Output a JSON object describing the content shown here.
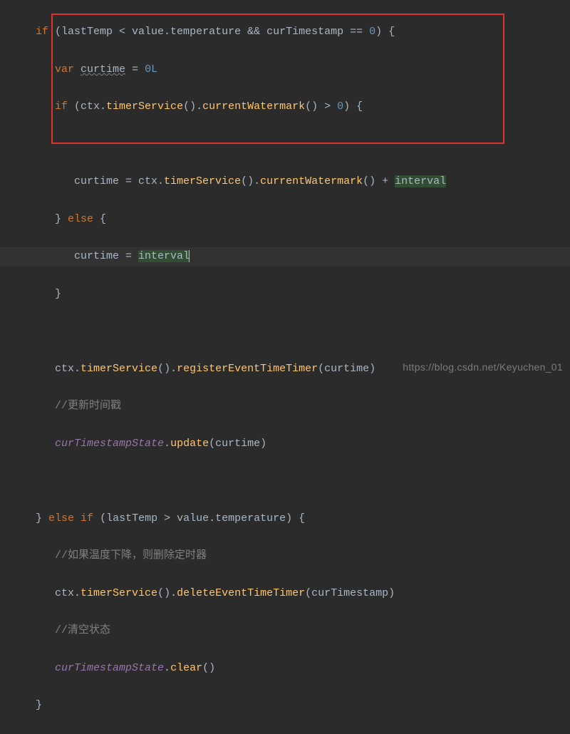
{
  "code": {
    "l1_if": "if",
    "l1_rest": " (lastTemp < value.temperature && curTimestamp == ",
    "l1_zero": "0",
    "l1_end": ") {",
    "l2_var": "var",
    "l2_sp": " ",
    "l2_curtime": "curtime",
    "l2_eq": " = ",
    "l2_val": "0L",
    "l3_if": "if",
    "l3_mid": " (ctx.",
    "l3_fn1": "timerService",
    "l3_mid2": "().",
    "l3_fn2": "currentWatermark",
    "l3_mid3": "() > ",
    "l3_zero": "0",
    "l3_end": ") {",
    "l5_a": "curtime = ctx.",
    "l5_fn1": "timerService",
    "l5_b": "().",
    "l5_fn2": "currentWatermark",
    "l5_c": "() + ",
    "l5_interval": "interval",
    "l6_close": "} ",
    "l6_else": "else",
    "l6_open": " {",
    "l7_a": "curtime = ",
    "l7_interval": "interval",
    "l8": "}",
    "l10_a": "ctx.",
    "l10_fn": "timerService",
    "l10_b": "().",
    "l10_fn2": "registerEventTimeTimer",
    "l10_c": "(curtime)",
    "l11": "//更新时间戳",
    "l12_a": "curTimestampState",
    "l12_b": ".",
    "l12_fn": "update",
    "l12_c": "(curtime)",
    "l14_a": "} ",
    "l14_else": "else",
    "l14_if": " if",
    "l14_b": " (lastTemp > value.temperature) {",
    "l15": "//如果温度下降，则删除定时器",
    "l16_a": "ctx.",
    "l16_fn": "timerService",
    "l16_b": "().",
    "l16_fn2": "deleteEventTimeTimer",
    "l16_c": "(curTimestamp)",
    "l17": "//清空状态",
    "l18_a": "curTimestampState",
    "l18_b": ".",
    "l18_fn": "clear",
    "l18_c": "()",
    "l19": "}"
  },
  "watermark": "https://blog.csdn.net/Keyuchen_01"
}
